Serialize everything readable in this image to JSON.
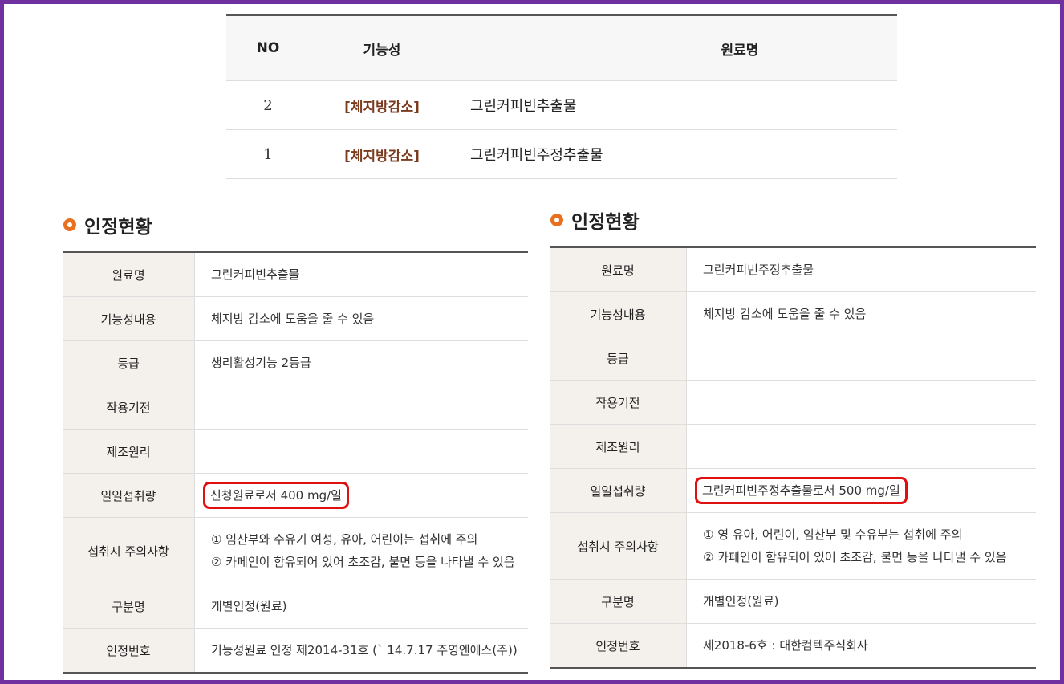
{
  "list": {
    "headers": {
      "no": "NO",
      "func": "기능성",
      "name": "원료명"
    },
    "rows": [
      {
        "no": "2",
        "func": "[체지방감소]",
        "name": "그린커피빈추출물"
      },
      {
        "no": "1",
        "func": "[체지방감소]",
        "name": "그린커피빈주정추출물"
      }
    ]
  },
  "left": {
    "title": "인정현황",
    "rows": [
      {
        "label": "원료명",
        "value": "그린커피빈추출물"
      },
      {
        "label": "기능성내용",
        "value": "체지방 감소에 도움을 줄 수 있음"
      },
      {
        "label": "등급",
        "value": "생리활성기능 2등급"
      },
      {
        "label": "작용기전",
        "value": ""
      },
      {
        "label": "제조원리",
        "value": ""
      },
      {
        "label": "일일섭취량",
        "value": "신청원료로서 400 mg/일"
      },
      {
        "label": "섭취시 주의사항",
        "value": "① 임산부와 수유기 여성, 유아, 어린이는 섭취에 주의",
        "value2": "② 카페인이 함유되어 있어 초조감, 불면 등을 나타낼 수 있음"
      },
      {
        "label": "구분명",
        "value": "개별인정(원료)"
      },
      {
        "label": "인정번호",
        "value": "기능성원료 인정 제2014-31호 (` 14.7.17 주영엔에스(주))"
      }
    ]
  },
  "right": {
    "title": "인정현황",
    "rows": [
      {
        "label": "원료명",
        "value": "그린커피빈주정추출물"
      },
      {
        "label": "기능성내용",
        "value": "체지방 감소에 도움을 줄 수 있음"
      },
      {
        "label": "등급",
        "value": ""
      },
      {
        "label": "작용기전",
        "value": ""
      },
      {
        "label": "제조원리",
        "value": ""
      },
      {
        "label": "일일섭취량",
        "value": "그린커피빈주정추출물로서 500 mg/일"
      },
      {
        "label": "섭취시 주의사항",
        "value": "① 영 유아, 어린이, 임산부 및 수유부는 섭취에 주의",
        "value2": "② 카페인이 함유되어 있어 초조감, 불면 등을 나타낼 수 있음"
      },
      {
        "label": "구분명",
        "value": "개별인정(원료)"
      },
      {
        "label": "인정번호",
        "value": "제2018-6호 : 대한컴텍주식회사"
      }
    ]
  },
  "colors": {
    "frame": "#7030a0",
    "accent_dot": "#e8701e",
    "highlight": "#e01010",
    "func_text": "#7a3b1e"
  }
}
